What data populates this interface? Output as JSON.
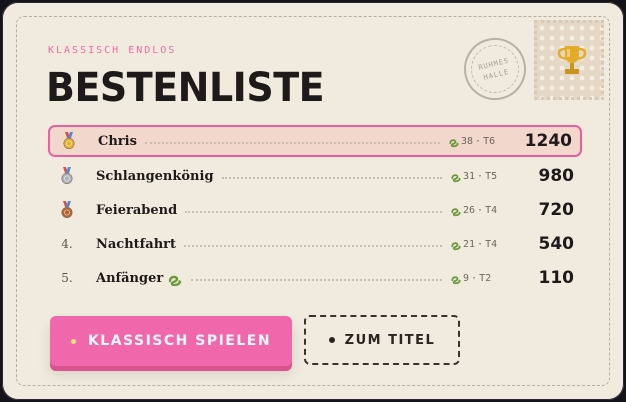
{
  "header": {
    "kicker": "KLASSISCH ENDLOS",
    "title": "BESTENLISTE",
    "seal_text": "RUHMES\nHALLE",
    "stamp_icon": "trophy-icon"
  },
  "leaderboard": [
    {
      "rank": "1.",
      "medal": "gold",
      "name": "Chris",
      "length": "38",
      "level": "T6",
      "score": "1240",
      "highlighted": true,
      "badge": false
    },
    {
      "rank": "2.",
      "medal": "silver",
      "name": "Schlangenkönig",
      "length": "31",
      "level": "T5",
      "score": "980",
      "highlighted": false,
      "badge": false
    },
    {
      "rank": "3.",
      "medal": "bronze",
      "name": "Feierabend",
      "length": "26",
      "level": "T4",
      "score": "720",
      "highlighted": false,
      "badge": false
    },
    {
      "rank": "4.",
      "medal": "",
      "name": "Nachtfahrt",
      "length": "21",
      "level": "T4",
      "score": "540",
      "highlighted": false,
      "badge": false
    },
    {
      "rank": "5.",
      "medal": "",
      "name": "Anfänger",
      "length": "9",
      "level": "T2",
      "score": "110",
      "highlighted": false,
      "badge": true
    }
  ],
  "stat_separator": "·",
  "buttons": {
    "play": "KLASSISCH SPIELEN",
    "title": "ZUM TITEL"
  },
  "colors": {
    "accent": "#f067ab",
    "card": "#f1ebdf",
    "gold": "#e6b22e",
    "silver": "#aeb4bb",
    "bronze": "#b5652e",
    "snake": "#6a9a3a"
  }
}
